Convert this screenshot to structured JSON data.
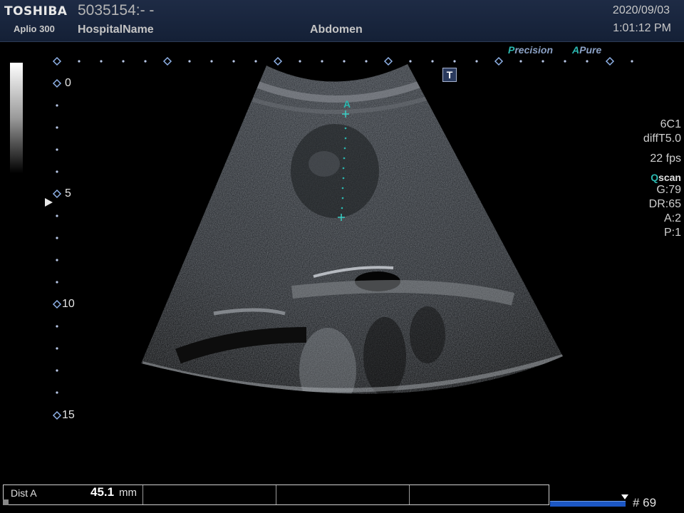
{
  "header": {
    "brand": "TOSHIBA",
    "model": "Aplio 300",
    "patient_id": "5035154:- -",
    "hospital": "HospitalName",
    "preset": "Abdomen",
    "date": "2020/09/03",
    "time": "1:01:12 PM",
    "background_color": "#142036"
  },
  "logos": {
    "precision_initial": "P",
    "precision_rest": "recision",
    "apure_initial": "A",
    "apure_rest": "Pure",
    "accent_color": "#2bb8b0"
  },
  "t_marker": "T",
  "depth_scale": {
    "labels": [
      "0",
      "5",
      "10",
      "15"
    ],
    "unit_max_cm": 15
  },
  "caliper": {
    "label": "A",
    "color": "#2bb8b0"
  },
  "parameters": {
    "probe": "6C1",
    "mode": "diffT5.0",
    "frame_rate": "22 fps",
    "qscan_initial": "Q",
    "qscan_rest": "scan",
    "gain": "G:79",
    "dynamic_range": "DR:65",
    "a": "A:2",
    "p": "P:1"
  },
  "measurement": {
    "label": "Dist A",
    "value": "45.1",
    "unit": "mm"
  },
  "cine": {
    "frame_count": "# 69",
    "bar_color": "#1c57c4"
  }
}
